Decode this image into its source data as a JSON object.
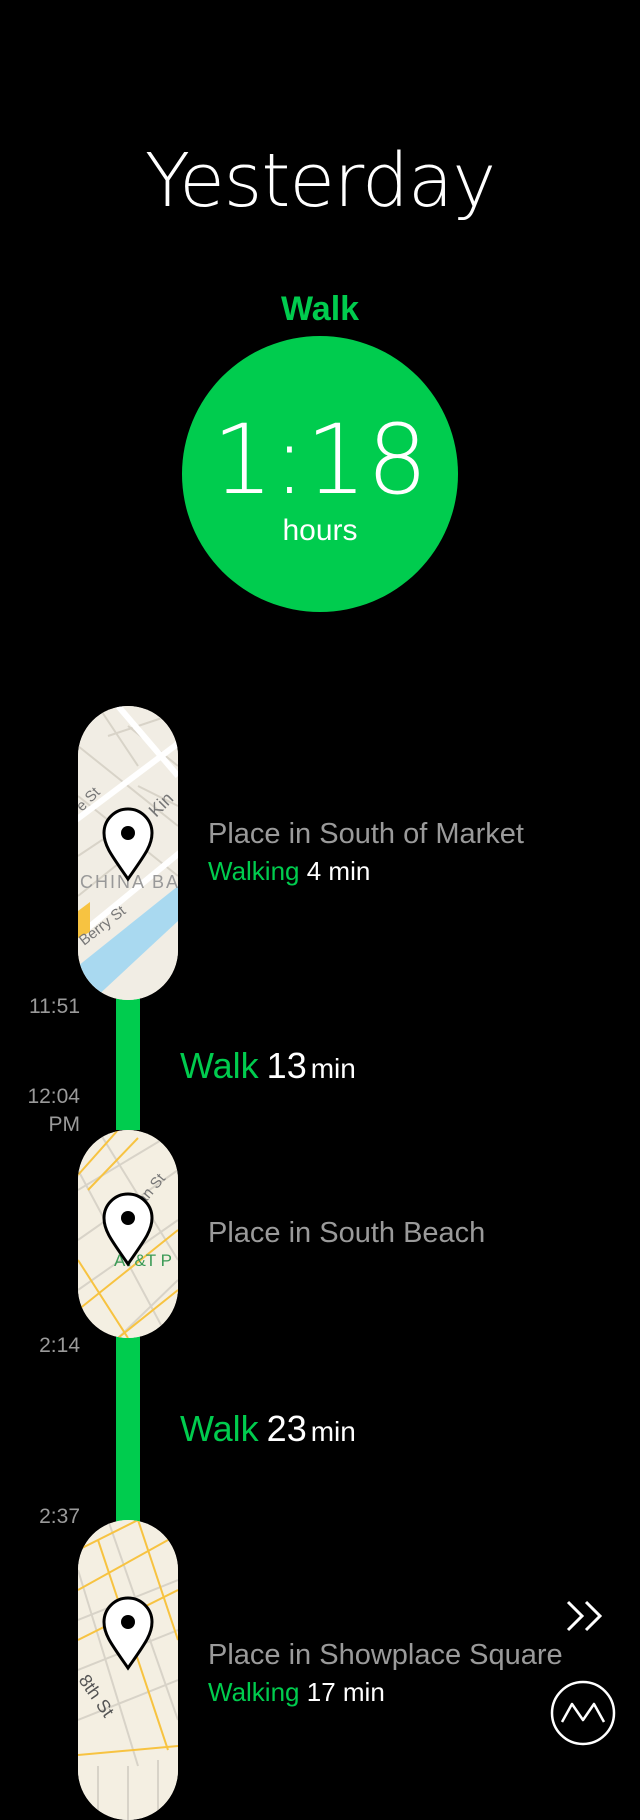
{
  "header": {
    "title": "Yesterday"
  },
  "summary": {
    "activity": "Walk",
    "duration": "1:18",
    "unit": "hours",
    "accent_color": "#00cc4e"
  },
  "timeline": {
    "places": [
      {
        "name": "Place in South of Market",
        "activity": "Walking",
        "duration": "4 min",
        "map_labels": [
          "Kin",
          "CHINA BA",
          "Berry St",
          "e St"
        ]
      },
      {
        "name": "Place in South Beach",
        "map_labels": [
          "AT&T P",
          "nan St"
        ]
      },
      {
        "name": "Place in Showplace Square",
        "activity": "Walking",
        "duration": "17 min",
        "map_labels": [
          "8th St"
        ]
      }
    ],
    "moves": [
      {
        "activity": "Walk",
        "amount": "13",
        "unit": "min"
      },
      {
        "activity": "Walk",
        "amount": "23",
        "unit": "min"
      }
    ],
    "times": [
      "11:51",
      "12:04",
      "PM",
      "2:14",
      "2:37"
    ]
  },
  "icons": {
    "pin": "map-pin-icon",
    "forward": "fast-forward-icon",
    "logo": "moves-logo-icon"
  }
}
